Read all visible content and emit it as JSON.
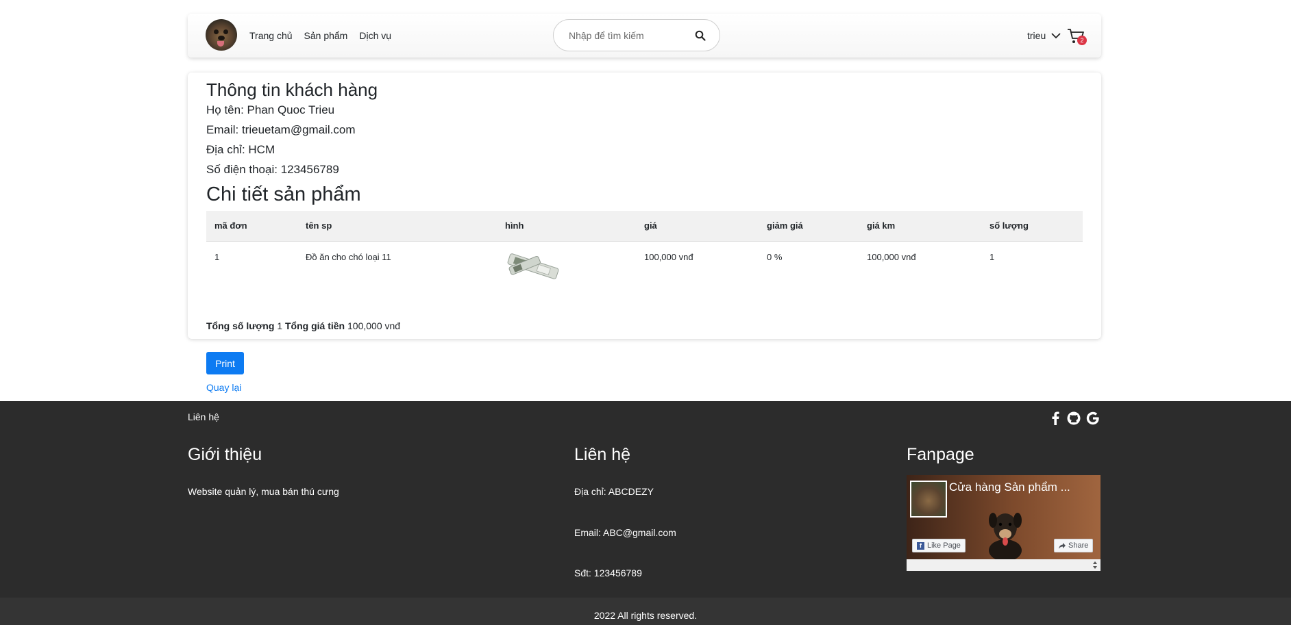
{
  "header": {
    "nav": [
      "Trang chủ",
      "Sản phẩm",
      "Dịch vụ"
    ],
    "search_placeholder": "Nhập để tìm kiếm",
    "user": "trieu",
    "cart_count": "2"
  },
  "customer": {
    "heading": "Thông tin khách hàng",
    "name": "Họ tên: Phan Quoc Trieu",
    "email": "Email: trieuetam@gmail.com",
    "address": "Địa chỉ: HCM",
    "phone": "Số điện thoại: 123456789"
  },
  "products": {
    "heading": "Chi tiết sản phẩm",
    "columns": [
      "mã đơn",
      "tên sp",
      "hình",
      "giá",
      "giảm giá",
      "giá km",
      "số lượng"
    ],
    "rows": [
      {
        "id": "1",
        "name": "Đồ ăn cho chó loại 11",
        "price": "100,000 vnđ",
        "discount": "0 %",
        "sale_price": "100,000 vnđ",
        "qty": "1"
      }
    ],
    "total_qty_label": "Tổng số lượng",
    "total_qty": "1",
    "total_price_label": "Tổng giá tiền",
    "total_price": "100,000 vnđ"
  },
  "actions": {
    "print": "Print",
    "back": "Quay lại"
  },
  "footer": {
    "contact_top": "Liên hệ",
    "about_heading": "Giới thiệu",
    "about_text": "Website quản lý, mua bán thú cưng",
    "contact_heading": "Liên hệ",
    "address": "Địa chỉ: ABCDEZY",
    "email": "Email: ABC@gmail.com",
    "phone": "Sđt: 123456789",
    "fanpage_heading": "Fanpage",
    "fanpage_title": "Cửa hàng Sản phẩm ...",
    "like_page": "Like Page",
    "share": "Share",
    "copyright": "2022 All rights reserved."
  },
  "colors": {
    "primary": "#0d7bf2",
    "footer_bg": "#2c2c2c",
    "badge": "#dc3545"
  }
}
